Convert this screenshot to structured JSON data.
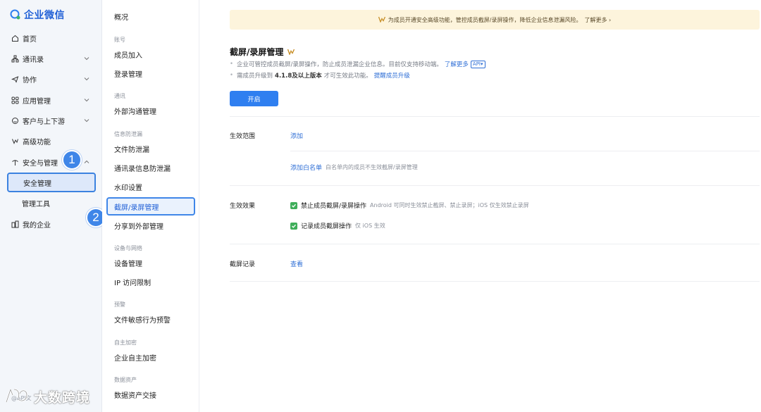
{
  "app": {
    "logo_text": "企业微信"
  },
  "sidebar": {
    "items": [
      {
        "label": "首页",
        "icon": "home-icon"
      },
      {
        "label": "通讯录",
        "icon": "org-icon"
      },
      {
        "label": "协作",
        "icon": "send-icon"
      },
      {
        "label": "应用管理",
        "icon": "grid-icon"
      },
      {
        "label": "客户与上下游",
        "icon": "chat-icon"
      },
      {
        "label": "高级功能",
        "icon": "vip-icon"
      },
      {
        "label": "安全与管理",
        "icon": "shield-icon"
      },
      {
        "label": "我的企业",
        "icon": "building-icon"
      }
    ],
    "sub_items": [
      {
        "label": "安全管理",
        "active": true
      },
      {
        "label": "管理工具",
        "active": false
      }
    ],
    "step_badges": [
      "1",
      "2"
    ]
  },
  "submenu": {
    "top": "概况",
    "groups": [
      {
        "title": "账号",
        "items": [
          "成员加入",
          "登录管理"
        ]
      },
      {
        "title": "通讯",
        "items": [
          "外部沟通管理"
        ]
      },
      {
        "title": "信息防泄漏",
        "items": [
          "文件防泄漏",
          "通讯录信息防泄漏",
          "水印设置",
          "截屏/录屏管理",
          "分享到外部管理"
        ]
      },
      {
        "title": "设备与网络",
        "items": [
          "设备管理",
          "IP 访问限制"
        ]
      },
      {
        "title": "预警",
        "items": [
          "文件敏感行为预警"
        ]
      },
      {
        "title": "自主加密",
        "items": [
          "企业自主加密"
        ]
      },
      {
        "title": "数据资产",
        "items": [
          "数据资产交接"
        ]
      }
    ],
    "active": "截屏/录屏管理"
  },
  "main": {
    "banner": {
      "text": "为成员开通安全高级功能，管控成员截屏/录屏操作，降低企业信息泄漏风险。",
      "more": "了解更多 ›"
    },
    "title": "截屏/录屏管理",
    "desc1": {
      "text": "企业可管控成员截屏/录屏操作，防止成员泄漏企业信息。目前仅支持移动端。",
      "link": "了解更多",
      "api": "API"
    },
    "desc2": {
      "prefix": "需成员升级到",
      "version": "4.1.8及以上版本",
      "suffix": "才可生效此功能。",
      "link": "提醒成员升级"
    },
    "enable_button": "开启",
    "scope": {
      "label": "生效范围",
      "add": "添加",
      "whitelist": "添加白名单",
      "whitelist_hint": "白名单内的成员不生效截屏/录屏管理"
    },
    "effect": {
      "label": "生效效果",
      "opt1": {
        "title": "禁止成员截屏/录屏操作",
        "hint": "Android 可同时生效禁止截屏、禁止录屏；iOS 仅生效禁止录屏"
      },
      "opt2": {
        "title": "记录成员截屏操作",
        "hint": "仅 iOS 生效"
      }
    },
    "records": {
      "label": "截屏记录",
      "view": "查看"
    }
  },
  "watermark": {
    "text": "大数跨境",
    "small": "@API文"
  },
  "colors": {
    "accent": "#2f7ff0",
    "banner_bg": "#fdf4dc",
    "check": "#3fae5a",
    "badge": "#3f86e8"
  }
}
